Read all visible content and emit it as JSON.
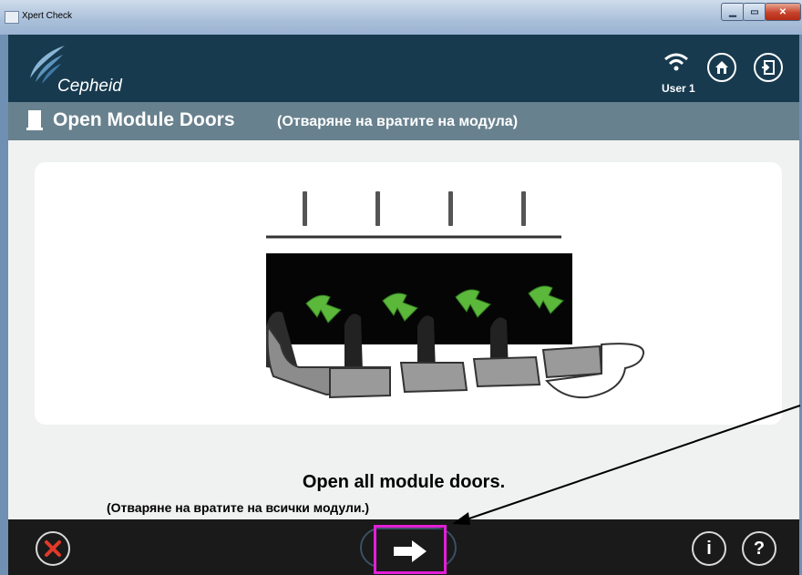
{
  "window": {
    "title": "Xpert Check",
    "controls": [
      "minimize-icon",
      "maximize-icon",
      "close-icon"
    ]
  },
  "header": {
    "logo_text": "Cepheid",
    "user_label": "User 1",
    "icons": [
      "wifi-icon",
      "home-icon",
      "logout-icon"
    ]
  },
  "step": {
    "icon": "door-icon",
    "title": "Open Module Doors",
    "title_translation": "(Отваряне на вратите на модула)"
  },
  "instruction": {
    "text": "Open all module doors.",
    "translation": "(Отваряне на вратите на всички модули.)"
  },
  "footer": {
    "cancel_icon": "cancel-x-icon",
    "next_icon": "right-arrow-icon",
    "info_label": "i",
    "help_label": "?"
  },
  "colors": {
    "header_bg": "#173a4f",
    "step_bar_bg": "#68818e",
    "footer_bg": "#1a1a1a",
    "cancel_red": "#e03a2a",
    "arrow_green": "#5cb83b",
    "highlight_magenta": "#e21fd7"
  }
}
